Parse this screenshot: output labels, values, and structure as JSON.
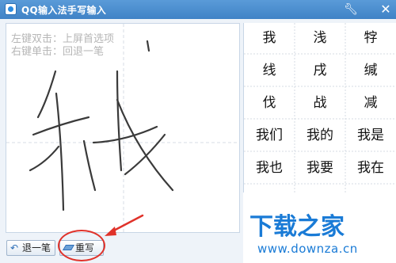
{
  "window": {
    "title": "QQ输入法手写输入",
    "accent": "#3f82c6"
  },
  "icons": {
    "app": "app-logo-icon",
    "settings": "wrench-icon",
    "close": "close-icon",
    "undo": "undo-arrow-icon",
    "clear": "eraser-icon"
  },
  "pad": {
    "hint_line1": "左键双击：上屏首选项",
    "hint_line2": "右键单击：回退一笔"
  },
  "candidates": [
    [
      "我",
      "浅",
      "牸"
    ],
    [
      "线",
      "戌",
      "缄"
    ],
    [
      "伐",
      "战",
      "减"
    ],
    [
      "我们",
      "我的",
      "我是"
    ],
    [
      "我也",
      "我要",
      "我在"
    ]
  ],
  "buttons": {
    "undo_label": "退一笔",
    "clear_label": "重写"
  },
  "annotation": {
    "highlight_color": "#e0322a"
  },
  "watermark": {
    "logo": "下载之家",
    "url": "www.downza.cn"
  }
}
